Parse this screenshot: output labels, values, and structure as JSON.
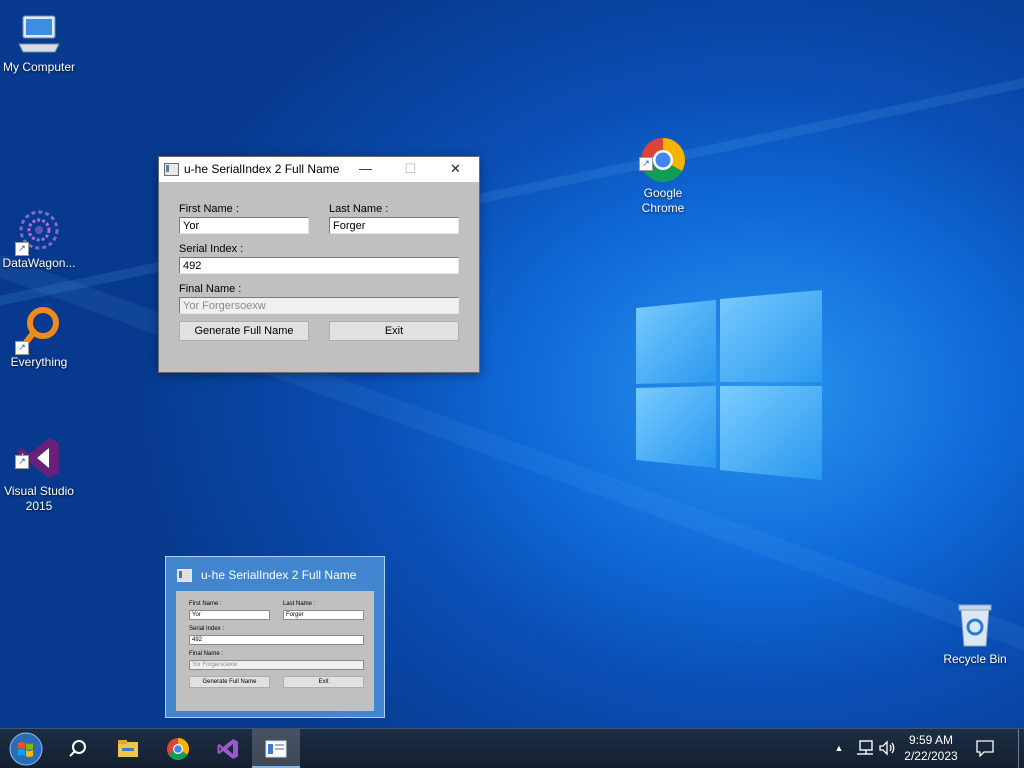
{
  "desktop": {
    "icons": {
      "my_computer": "My Computer",
      "datawagon": "DataWagon...",
      "everything": "Everything",
      "visual_studio": "Visual Studio\n2015",
      "google_chrome": "Google\nChrome",
      "recycle_bin": "Recycle Bin"
    },
    "accent_color": "#0f6ad8"
  },
  "window": {
    "title": "u-he SerialIndex 2 Full Name",
    "first_name_label": "First Name :",
    "first_name_value": "Yor",
    "last_name_label": "Last Name :",
    "last_name_value": "Forger",
    "serial_index_label": "Serial Index :",
    "serial_index_value": "492",
    "final_name_label": "Final Name :",
    "final_name_value": "Yor Forgersoexw",
    "generate_button": "Generate Full Name",
    "exit_button": "Exit",
    "minimize_glyph": "—",
    "maximize_glyph": "☐",
    "close_glyph": "✕"
  },
  "preview": {
    "title": "u-he SerialIndex 2 Full Name"
  },
  "taskbar": {
    "items": [
      "start-orb",
      "search-icon",
      "file-explorer-icon",
      "chrome-icon",
      "visual-studio-icon",
      "serialindex-app-icon"
    ],
    "active_item": "serialindex-app-icon",
    "clock_time": "9:59 AM",
    "clock_date": "2/22/2023"
  }
}
